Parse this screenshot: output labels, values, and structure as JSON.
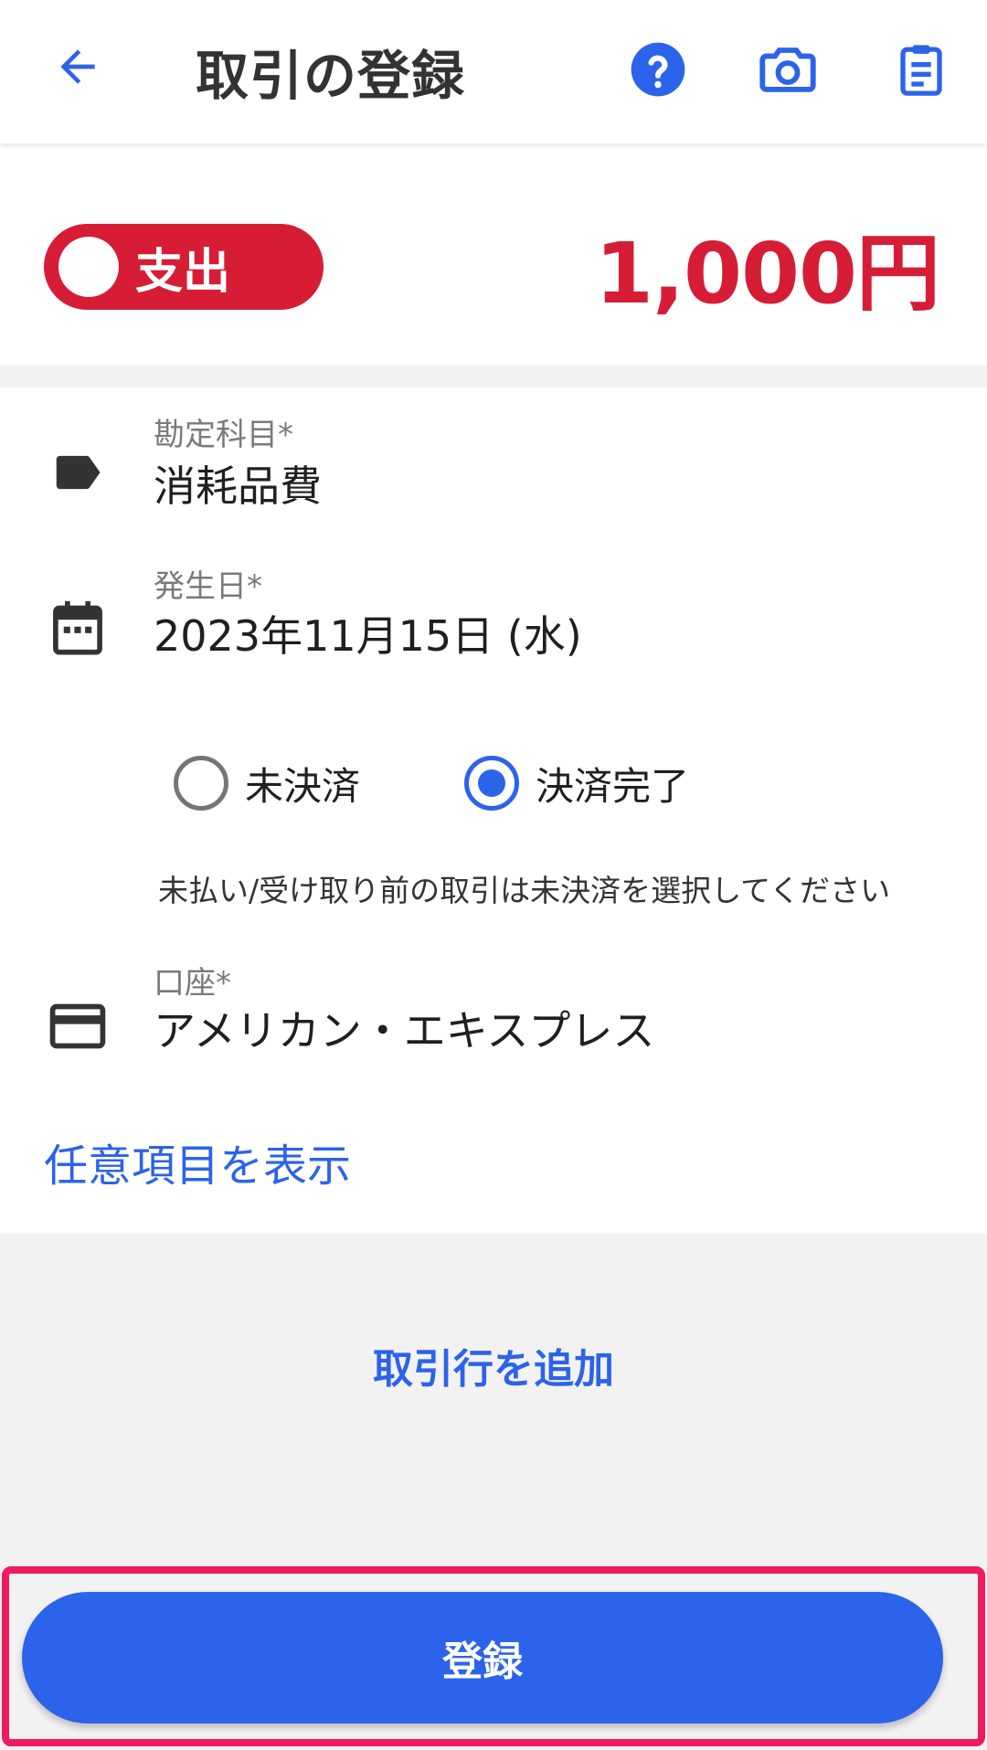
{
  "header": {
    "title": "取引の登録",
    "icons": {
      "back": "arrow-back-icon",
      "help": "help-circle-icon",
      "camera": "camera-icon",
      "clipboard": "clipboard-icon"
    }
  },
  "transaction": {
    "type_label": "支出",
    "amount": "1,000円"
  },
  "form": {
    "account_title": {
      "label": "勘定科目*",
      "value": "消耗品費",
      "icon": "label-tag-icon"
    },
    "date": {
      "label": "発生日*",
      "value": "2023年11月15日 (水)",
      "icon": "calendar-icon"
    },
    "settlement": {
      "unpaid_label": "未決済",
      "paid_label": "決済完了",
      "selected": "決済完了",
      "hint": "未払い/受け取り前の取引は未決済を選択してください"
    },
    "wallet": {
      "label": "口座*",
      "value": "アメリカン・エキスプレス",
      "icon": "credit-card-icon"
    },
    "show_optional": "任意項目を表示"
  },
  "actions": {
    "add_row": "取引行を追加",
    "submit": "登録"
  },
  "colors": {
    "accent": "#2b63ea",
    "expense_red": "#d71c35",
    "highlight_frame": "#f01b5c",
    "background_gray": "#f3f2f3"
  }
}
